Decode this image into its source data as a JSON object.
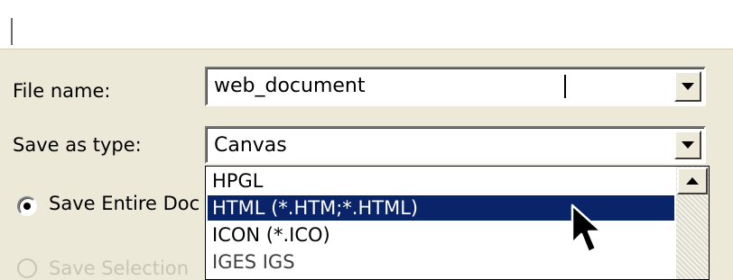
{
  "file_name": {
    "label": "File name:",
    "value": "web_document"
  },
  "save_as_type": {
    "label": "Save as type:",
    "value": "Canvas",
    "options": [
      {
        "label": "HPGL",
        "selected": false
      },
      {
        "label": "HTML (*.HTM;*.HTML)",
        "selected": true
      },
      {
        "label": "ICON (*.ICO)",
        "selected": false
      },
      {
        "label": "IGES IGS",
        "selected": false
      }
    ]
  },
  "save_options": {
    "entire_document_label": "Save Entire Doc",
    "entire_document_checked": true,
    "selection_label": "Save Selection",
    "selection_enabled": false
  },
  "colors": {
    "dialog_face": "#ece9d8",
    "selection_highlight": "#0a246a",
    "selection_text": "#ffffff",
    "disabled_text": "#c8c5b6"
  },
  "icons": [
    "dropdown-arrow-icon",
    "scroll-up-arrow-icon",
    "mouse-pointer-icon"
  ]
}
